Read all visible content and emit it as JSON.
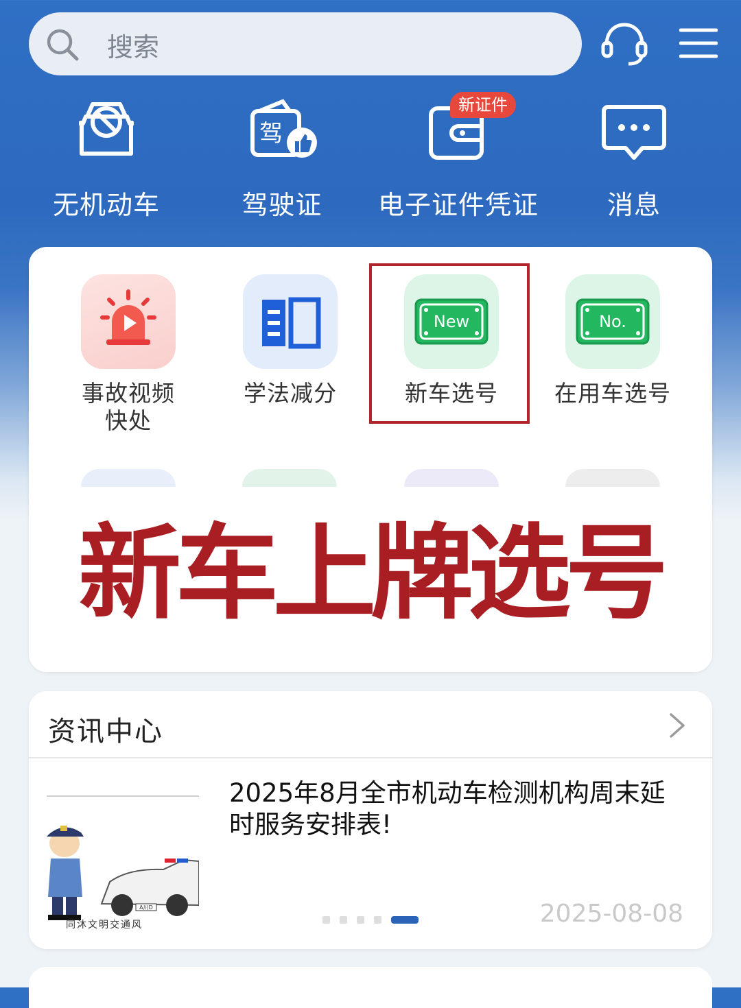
{
  "search": {
    "placeholder": "搜索"
  },
  "quick_actions": [
    {
      "label": "无机动车",
      "icon": "no-vehicle-icon"
    },
    {
      "label": "驾驶证",
      "icon": "driver-license-icon"
    },
    {
      "label": "电子证件凭证",
      "icon": "e-wallet-icon",
      "badge": "新证件"
    },
    {
      "label": "消息",
      "icon": "message-icon"
    }
  ],
  "services": [
    {
      "label": "事故视频快处",
      "icon": "siren-video-icon"
    },
    {
      "label": "学法减分",
      "icon": "book-icon"
    },
    {
      "label": "新车选号",
      "icon": "new-plate-icon",
      "plate_text": "New"
    },
    {
      "label": "在用车选号",
      "icon": "no-plate-icon",
      "plate_text": "No."
    }
  ],
  "overlay": {
    "title": "新车上牌选号"
  },
  "news": {
    "title": "资讯中心",
    "headline": "2025年8月全市机动车检测机构周末延时服务安排表!",
    "date": "2025-08-08",
    "thumb_caption": "同沐文明交通风",
    "thumb_plate": "A川D",
    "carousel_total": 5,
    "carousel_active": 5
  },
  "colors": {
    "header_blue": "#2f6fc4",
    "highlight": "#b0262c",
    "overlay_text": "#a81e23",
    "badge": "#e8483c",
    "carousel_active": "#2a63b8"
  }
}
